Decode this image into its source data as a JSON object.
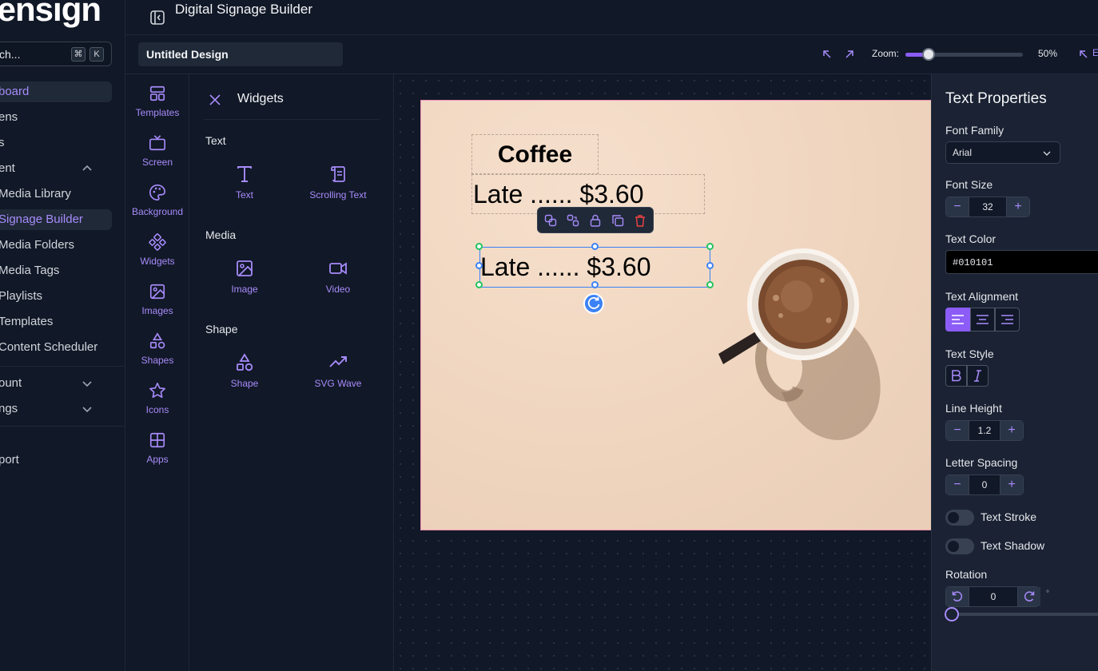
{
  "sidebar": {
    "logo": "pensign",
    "search": {
      "text": "ch...",
      "kbd1": "⌘",
      "kbd2": "K"
    },
    "items": [
      {
        "label": "board"
      },
      {
        "label": "ens"
      },
      {
        "label": "s"
      },
      {
        "label": "ent"
      },
      {
        "label": "Media Library"
      },
      {
        "label": "Signage Builder"
      },
      {
        "label": "Media Folders"
      },
      {
        "label": "Media Tags"
      },
      {
        "label": "Playlists"
      },
      {
        "label": "Templates"
      },
      {
        "label": "Content Scheduler"
      },
      {
        "label": "ount"
      },
      {
        "label": "ngs"
      },
      {
        "label": "port"
      }
    ]
  },
  "header": {
    "title": "Digital Signage Builder"
  },
  "toolbar": {
    "design_name": "Untitled Design",
    "zoom_label": "Zoom:",
    "zoom_value": "50%",
    "zoom_level": 0.2
  },
  "rail": {
    "items": [
      {
        "label": "Templates",
        "icon": "templates-icon"
      },
      {
        "label": "Screen",
        "icon": "tv-icon"
      },
      {
        "label": "Background",
        "icon": "palette-icon"
      },
      {
        "label": "Widgets",
        "icon": "widgets-icon"
      },
      {
        "label": "Images",
        "icon": "image-icon"
      },
      {
        "label": "Shapes",
        "icon": "shapes-icon"
      },
      {
        "label": "Icons",
        "icon": "star-icon"
      },
      {
        "label": "Apps",
        "icon": "apps-icon"
      }
    ]
  },
  "widgets": {
    "title": "Widgets",
    "sections": [
      {
        "name": "Text",
        "items": [
          "Text",
          "Scrolling Text"
        ]
      },
      {
        "name": "Media",
        "items": [
          "Image",
          "Video"
        ]
      },
      {
        "name": "Shape",
        "items": [
          "Shape",
          "SVG Wave"
        ]
      }
    ]
  },
  "canvas": {
    "title": "Coffee",
    "line1": "Late ...... $3.60",
    "line2": "Late ...... $3.60"
  },
  "props": {
    "title": "Text Properties",
    "font_family_label": "Font Family",
    "font_family": "Arial",
    "font_size_label": "Font Size",
    "font_size": "32",
    "text_color_label": "Text Color",
    "text_color": "#010101",
    "alignment_label": "Text Alignment",
    "style_label": "Text Style",
    "line_height_label": "Line Height",
    "line_height": "1.2",
    "letter_spacing_label": "Letter Spacing",
    "letter_spacing": "0",
    "stroke_label": "Text Stroke",
    "shadow_label": "Text Shadow",
    "rotation_label": "Rotation",
    "rotation": "0",
    "degree_symbol": "°"
  },
  "colors": {
    "accent": "#8b5cf6",
    "accent_light": "#a78bfa",
    "bg": "#111827",
    "panel": "#1a2233",
    "selection": "#3b82f6",
    "delete": "#ef4444"
  }
}
